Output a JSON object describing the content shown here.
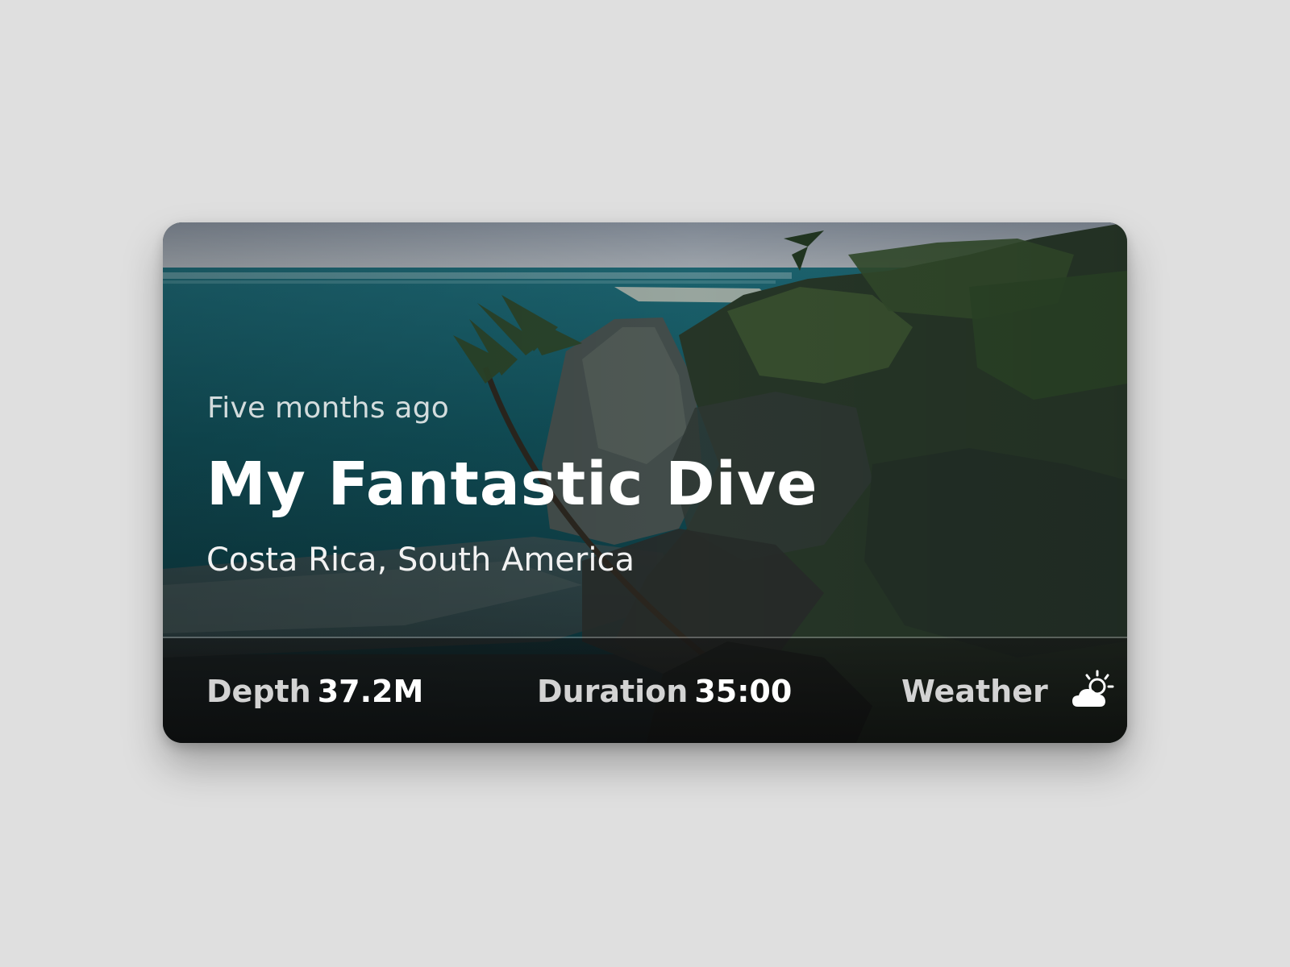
{
  "card": {
    "time_ago": "Five months ago",
    "title": "My Fantastic Dive",
    "location": "Costa Rica, South America"
  },
  "stats": {
    "depth_label": "Depth",
    "depth_value": "37.2M",
    "duration_label": "Duration",
    "duration_value": "35:00",
    "weather_label": "Weather",
    "weather_icon": "partly-cloudy-icon"
  },
  "colors": {
    "page_background": "#dfdfdf",
    "text_primary": "#ffffff",
    "text_secondary": "#d3d3d3"
  }
}
